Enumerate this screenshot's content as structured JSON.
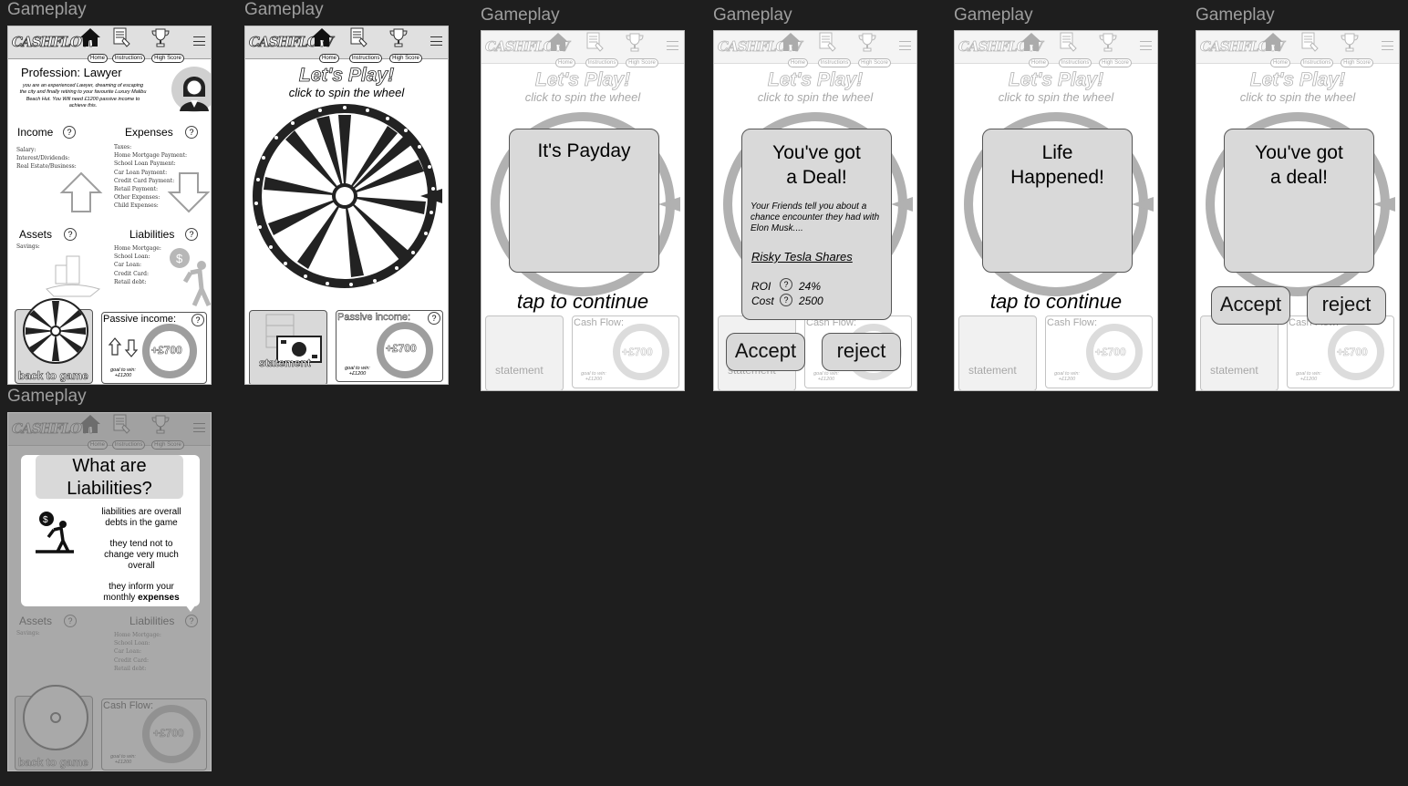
{
  "frame_label": "Gameplay",
  "nav": {
    "logo": "CASHFLOW",
    "home": "Home",
    "instructions": "Instructions",
    "high_score": "High Score"
  },
  "profile": {
    "title": "Profession: Lawyer",
    "desc": "you are an experienced Lawyer, dreaming of escaping the city and finally retiring to your favourite Luxury Malibu Beach Hut. You Will need £1200 passive income to achieve this.",
    "income": "Income",
    "expenses": "Expenses",
    "income_items": [
      "Salary:",
      "Interest/Dividends:",
      "Real Estate/Business:"
    ],
    "expense_items": [
      "Taxes:",
      "Home Mortgage Payment:",
      "School Loan Payment:",
      "Car Loan Payment:",
      "Credit Card Payment:",
      "Retail Payment:",
      "Other Expenses:",
      "Child Expenses:"
    ],
    "assets": "Assets",
    "liabilities": "Liabilities",
    "asset_items": [
      "Savings:"
    ],
    "liability_items": [
      "Home Mortgage:",
      "School Loan:",
      "Car Loan:",
      "Credit Card:",
      "Retail debt:"
    ],
    "back": "back to game"
  },
  "passive": {
    "label": "Passive income:",
    "value": "+£700",
    "goal": "goal to win:",
    "goal_value": "+£1200"
  },
  "cashflow": {
    "label": "Cash Flow:",
    "value": "+£700"
  },
  "statement": "statement",
  "play": {
    "title": "Let's Play!",
    "subtitle": "click to spin the wheel"
  },
  "payday": {
    "title": "It's Payday",
    "tap": "tap to continue"
  },
  "deal": {
    "title1": "You've got",
    "title2": "a Deal!",
    "story": "Your Friends tell you about a chance encounter they had with Elon Musk....",
    "name": "Risky Tesla Shares",
    "roi_label": "ROI",
    "roi": "24%",
    "cost_label": "Cost",
    "cost": "2500",
    "accept": "Accept",
    "reject": "reject"
  },
  "life": {
    "title1": "Life",
    "title2": "Happened!",
    "tap": "tap to continue"
  },
  "deal2": {
    "title1": "You've got",
    "title2": "a deal!",
    "accept": "Accept",
    "reject": "reject"
  },
  "liab_help": {
    "title1": "What are",
    "title2": "Liabilities?",
    "line1": "liabilities are overall debts in the game",
    "line2": "they tend not to change very much overall",
    "line3a": "they inform your monthly",
    "line3b": "expenses"
  },
  "help_glyph": "?"
}
